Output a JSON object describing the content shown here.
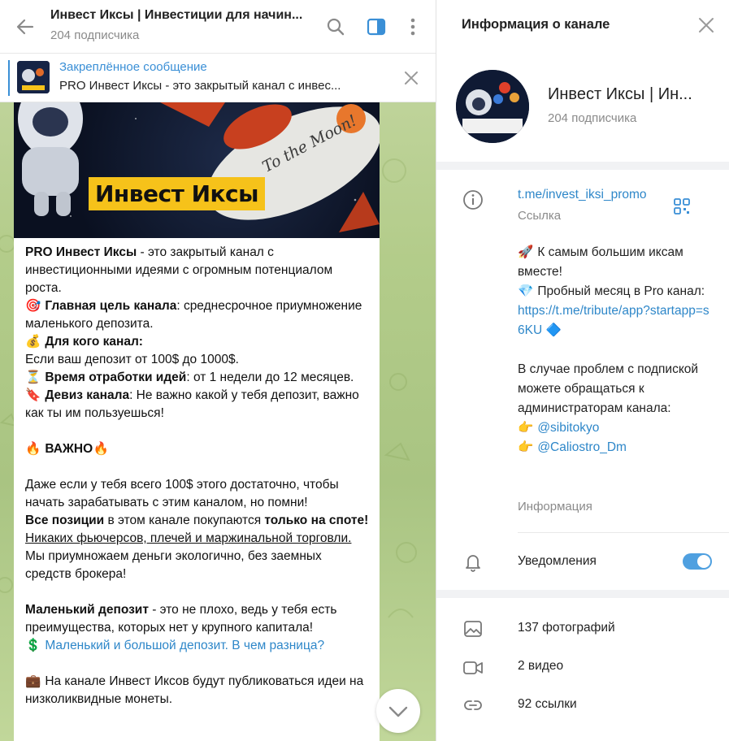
{
  "chat": {
    "title": "Инвест Иксы | Инвестиции для начин...",
    "subscribers": "204 подписчика"
  },
  "pinned": {
    "label": "Закреплённое сообщение",
    "bold_part": "PRO Инвест Иксы",
    "rest": " - это закрытый канал с инвес..."
  },
  "banner": {
    "title": "Инвест Иксы",
    "rocket_text": "To the Moon!"
  },
  "message": {
    "p1_bold": "PRO Инвест Иксы",
    "p1_rest": " - это закрытый канал с инвестиционными  идеями с огромным потенциалом роста.",
    "goal_emoji": "🎯",
    "goal_bold": "Главная цель канала",
    "goal_rest": ": среднесрочное приумножение маленького депозита.",
    "who_emoji": "💰",
    "who_bold": "Для кого канал:",
    "who_rest": "Если ваш депозит от 100$ до 1000$.",
    "time_emoji": "⏳",
    "time_bold": "Время отработки идей",
    "time_rest": ": от 1 недели до 12 месяцев.",
    "motto_emoji": "🔖",
    "motto_bold": "Девиз канала",
    "motto_rest": ": Не важно какой у тебя депозит, важно как ты им пользуешься!",
    "important_emoji": "🔥",
    "important": "ВАЖНО",
    "p3": "Даже если у тебя всего 100$ этого достаточно, чтобы начать зарабатывать с этим каналом, но помни!",
    "p4_bold1": "Все позиции",
    "p4_mid": " в этом канале покупаются ",
    "p4_bold2": "только на споте!",
    "p5_underline": "Никаких фьючерсов, плечей и маржинальной торговли.",
    "p5_rest": " Мы приумножаем деньги экологично, без заемных средств брокера!",
    "p6_bold": "Маленький депозит",
    "p6_rest": " - это не плохо, ведь у тебя есть преимущества, которых нет у крупного капитала!",
    "p7_emoji": "💲",
    "p7_link": "Маленький и большой депозит. В чем разница?",
    "p8_emoji": "💼",
    "p8": "На канале Инвест Иксов будут публиковаться идеи на низколиквидные монеты."
  },
  "info": {
    "title": "Информация о канале",
    "channel_name": "Инвест Иксы | Ин...",
    "subscribers": "204 подписчика",
    "link": "t.me/invest_iksi_promo",
    "link_label": "Ссылка",
    "desc_line1_emoji": "🚀",
    "desc_line1": "К самым большим иксам вместе!",
    "desc_line2_emoji": "💎",
    "desc_line2": "Пробный месяц в Pro канал:",
    "desc_link": "https://t.me/tribute/app?startapp=s6KU",
    "desc_link_emoji": "🔷",
    "desc_para2": "В случае проблем с подпиской можете обращаться к администраторам канала:",
    "admin_emoji": "👉",
    "admin1": "@sibitokyo",
    "admin2": "@Caliostro_Dm",
    "desc_label": "Информация",
    "notifications_label": "Уведомления",
    "notifications_on": true,
    "photos": "137 фотографий",
    "videos": "2 видео",
    "links": "92 ссылки"
  },
  "colors": {
    "accent": "#3a8fd6",
    "link": "#2e87c9",
    "toggle": "#4fa0e0",
    "banner_yellow": "#f6c21a"
  }
}
